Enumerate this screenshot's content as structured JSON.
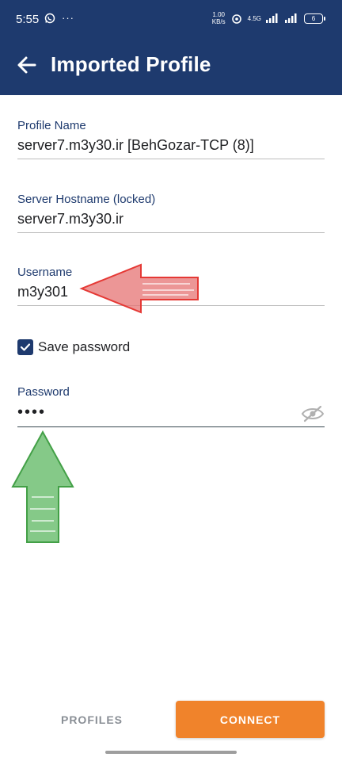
{
  "status_bar": {
    "time": "5:55",
    "more": "···",
    "net_speed_top": "1.00",
    "net_speed_bottom": "KB/s",
    "net_type": "4.5G",
    "battery": "6"
  },
  "app_bar": {
    "title": "Imported Profile"
  },
  "form": {
    "profile_name_label": "Profile Name",
    "profile_name_value": "server7.m3y30.ir [BehGozar-TCP (8)]",
    "hostname_label": "Server Hostname (locked)",
    "hostname_value": "server7.m3y30.ir",
    "username_label": "Username",
    "username_value": "m3y301",
    "save_password_label": "Save password",
    "save_password_checked": true,
    "password_label": "Password",
    "password_value": "••••"
  },
  "actions": {
    "profiles_label": "PROFILES",
    "connect_label": "CONNECT"
  },
  "colors": {
    "primary": "#1e3a6e",
    "accent": "#f0832b",
    "annotation_red": "#e53935",
    "annotation_green": "#43a047"
  },
  "icons": [
    "whatsapp-icon",
    "wifi-icon",
    "signal-icon",
    "battery-icon",
    "back-arrow-icon",
    "check-icon",
    "eye-off-icon"
  ]
}
